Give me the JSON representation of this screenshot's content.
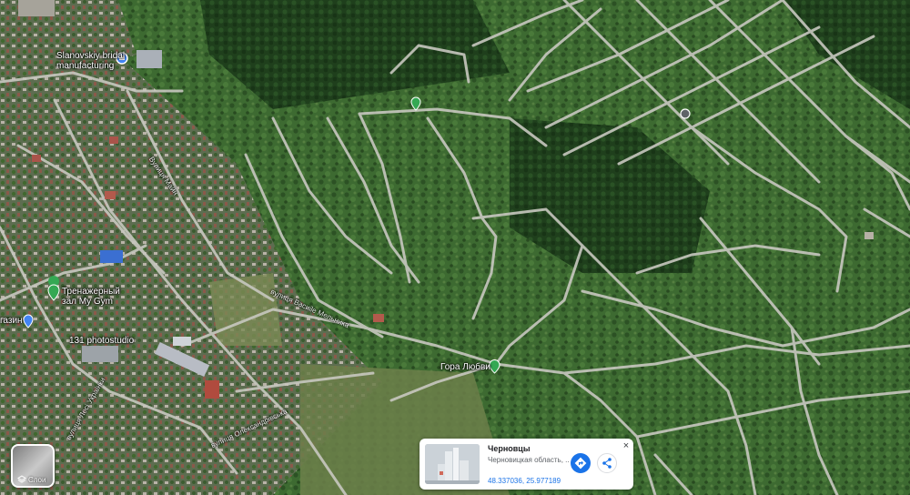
{
  "map_labels": {
    "slanovskiy": "Slanovskiy bridal\nmanufacturing",
    "gym_line1": "Тренажерный",
    "gym_line2": "зал My Gym",
    "shop": "газин",
    "photo": "131 photostudio",
    "hill": "Гора Любви",
    "street_mielnik": "вулиця Васиile Мельника",
    "street_main": "Вулиця Майн",
    "street_alex": "вулиця Олександрівська",
    "street_lower": "вулиця Лесі Українки"
  },
  "layers": {
    "label": "Слои",
    "icon": "layers-icon"
  },
  "place_card": {
    "title": "Черновцы",
    "subtitle": "Черновицкая область, ...",
    "coords": "48.337036, 25.977189",
    "directions_icon": "directions-icon",
    "share_icon": "share-icon",
    "close": "×"
  },
  "colors": {
    "forest": "#2f5a28",
    "road": "#c8c8c0",
    "accent": "#1a73e8",
    "pin_green": "#34a853",
    "pin_blue": "#4285f4"
  }
}
